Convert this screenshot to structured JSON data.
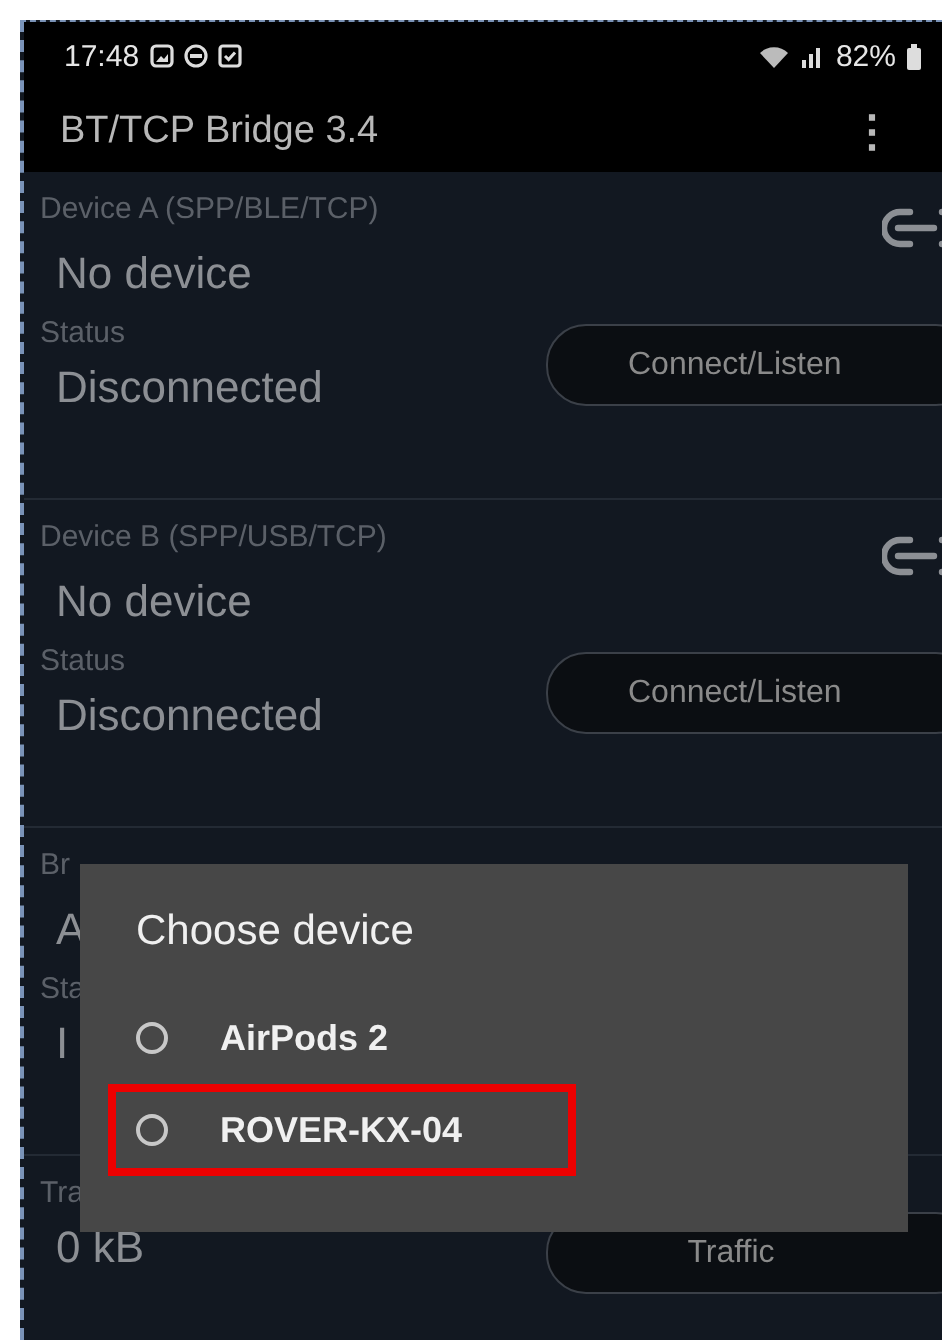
{
  "status_bar": {
    "time": "17:48",
    "battery": "82%"
  },
  "app_bar": {
    "title": "BT/TCP Bridge 3.4",
    "menu": "⋮"
  },
  "sections": [
    {
      "kind": "device",
      "label": "Device A (SPP/BLE/TCP)",
      "value": "No device",
      "status_label": "Status",
      "status_value": "Disconnected",
      "button": "Connect/Listen",
      "link_icon": true
    },
    {
      "kind": "device",
      "label": "Device B (SPP/USB/TCP)",
      "value": "No device",
      "status_label": "Status",
      "status_value": "Disconnected",
      "button": "Connect/Listen",
      "link_icon": true
    },
    {
      "kind": "device",
      "label": "Br",
      "value": "A",
      "status_label": "Sta",
      "status_value": "I"
    },
    {
      "kind": "counter",
      "label": "Tra",
      "value": "0 kB",
      "button": "Traffic"
    }
  ],
  "dialog": {
    "title": "Choose device",
    "options": [
      {
        "label": "AirPods 2",
        "selected": false,
        "highlighted": false
      },
      {
        "label": "ROVER-KX-04",
        "selected": false,
        "highlighted": true
      }
    ]
  }
}
